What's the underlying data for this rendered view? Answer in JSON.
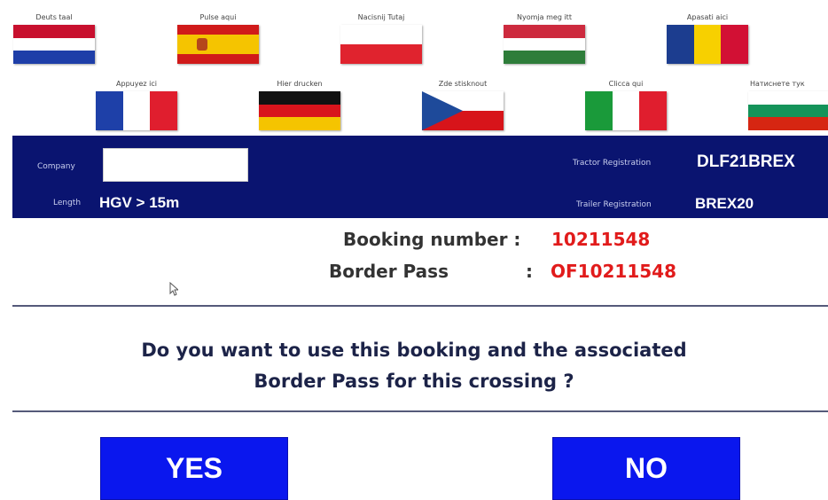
{
  "languages": [
    {
      "caption": "Deuts taal",
      "flag": "netherlands-flag"
    },
    {
      "caption": "Pulse aqui",
      "flag": "spain-flag"
    },
    {
      "caption": "Nacisnij Tutaj",
      "flag": "poland-flag"
    },
    {
      "caption": "Nyomja meg itt",
      "flag": "hungary-flag"
    },
    {
      "caption": "Apasati aici",
      "flag": "romania-flag"
    },
    {
      "caption": "Appuyez ici",
      "flag": "france-flag"
    },
    {
      "caption": "Hier drucken",
      "flag": "germany-flag"
    },
    {
      "caption": "Zde stisknout",
      "flag": "czech-flag"
    },
    {
      "caption": "Clicca qui",
      "flag": "italy-flag"
    },
    {
      "caption": "Натиснете тук",
      "flag": "bulgaria-flag"
    }
  ],
  "flag_colors": {
    "netherlands": [
      "#c8102e",
      "#ffffff",
      "#1e3ea8"
    ],
    "spain": [
      "#d01a1a",
      "#f5c400",
      "#d01a1a"
    ],
    "poland": [
      "#ffffff",
      "#e0232e"
    ],
    "hungary": [
      "#cd2a3e",
      "#ffffff",
      "#2e7d3a"
    ],
    "romania": [
      "#1c3d8f",
      "#f7d000",
      "#d21034"
    ],
    "france": [
      "#1e40a8",
      "#ffffff",
      "#e01e2e"
    ],
    "germany": [
      "#111111",
      "#d8141c",
      "#f5c400"
    ],
    "czech": [
      "#ffffff",
      "#d7141a",
      "#1e4a9a"
    ],
    "italy": [
      "#1a9a3a",
      "#ffffff",
      "#e01e2e"
    ],
    "bulgaria": [
      "#ffffff",
      "#14935a",
      "#d62612"
    ]
  },
  "info": {
    "company_label": "Company",
    "company_value": "",
    "length_label": "Length",
    "length_value": "HGV > 15m",
    "tractor_label": "Tractor Registration",
    "tractor_value": "DLF21BREX",
    "trailer_label": "Trailer Registration",
    "trailer_value": "BREX20"
  },
  "booking": {
    "number_label": "Booking number :",
    "number_value": "10211548",
    "pass_label": "Border Pass",
    "pass_colon": ":",
    "pass_value": "OF10211548"
  },
  "question": {
    "line1": "Do you want to use this booking and the associated",
    "line2": "Border Pass for this crossing ?"
  },
  "buttons": {
    "yes": "YES",
    "no": "NO"
  },
  "colors": {
    "band": "#0a1470",
    "button": "#0a17ee",
    "highlight": "#e11b1b"
  }
}
